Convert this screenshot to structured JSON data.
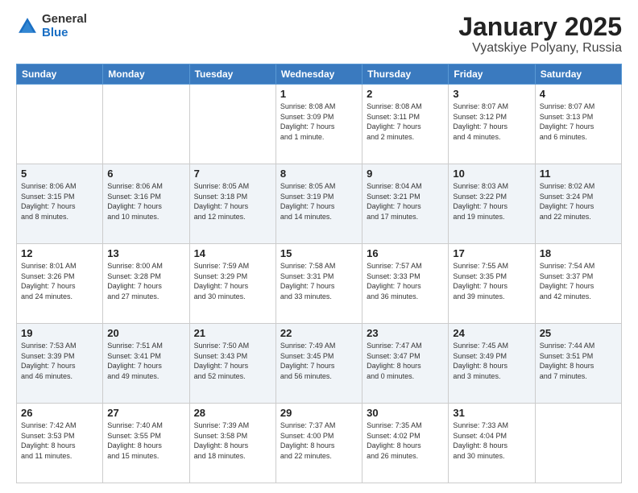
{
  "logo": {
    "general": "General",
    "blue": "Blue"
  },
  "title": "January 2025",
  "subtitle": "Vyatskiye Polyany, Russia",
  "days_of_week": [
    "Sunday",
    "Monday",
    "Tuesday",
    "Wednesday",
    "Thursday",
    "Friday",
    "Saturday"
  ],
  "weeks": [
    [
      {
        "day": "",
        "info": ""
      },
      {
        "day": "",
        "info": ""
      },
      {
        "day": "",
        "info": ""
      },
      {
        "day": "1",
        "info": "Sunrise: 8:08 AM\nSunset: 3:09 PM\nDaylight: 7 hours\nand 1 minute."
      },
      {
        "day": "2",
        "info": "Sunrise: 8:08 AM\nSunset: 3:11 PM\nDaylight: 7 hours\nand 2 minutes."
      },
      {
        "day": "3",
        "info": "Sunrise: 8:07 AM\nSunset: 3:12 PM\nDaylight: 7 hours\nand 4 minutes."
      },
      {
        "day": "4",
        "info": "Sunrise: 8:07 AM\nSunset: 3:13 PM\nDaylight: 7 hours\nand 6 minutes."
      }
    ],
    [
      {
        "day": "5",
        "info": "Sunrise: 8:06 AM\nSunset: 3:15 PM\nDaylight: 7 hours\nand 8 minutes."
      },
      {
        "day": "6",
        "info": "Sunrise: 8:06 AM\nSunset: 3:16 PM\nDaylight: 7 hours\nand 10 minutes."
      },
      {
        "day": "7",
        "info": "Sunrise: 8:05 AM\nSunset: 3:18 PM\nDaylight: 7 hours\nand 12 minutes."
      },
      {
        "day": "8",
        "info": "Sunrise: 8:05 AM\nSunset: 3:19 PM\nDaylight: 7 hours\nand 14 minutes."
      },
      {
        "day": "9",
        "info": "Sunrise: 8:04 AM\nSunset: 3:21 PM\nDaylight: 7 hours\nand 17 minutes."
      },
      {
        "day": "10",
        "info": "Sunrise: 8:03 AM\nSunset: 3:22 PM\nDaylight: 7 hours\nand 19 minutes."
      },
      {
        "day": "11",
        "info": "Sunrise: 8:02 AM\nSunset: 3:24 PM\nDaylight: 7 hours\nand 22 minutes."
      }
    ],
    [
      {
        "day": "12",
        "info": "Sunrise: 8:01 AM\nSunset: 3:26 PM\nDaylight: 7 hours\nand 24 minutes."
      },
      {
        "day": "13",
        "info": "Sunrise: 8:00 AM\nSunset: 3:28 PM\nDaylight: 7 hours\nand 27 minutes."
      },
      {
        "day": "14",
        "info": "Sunrise: 7:59 AM\nSunset: 3:29 PM\nDaylight: 7 hours\nand 30 minutes."
      },
      {
        "day": "15",
        "info": "Sunrise: 7:58 AM\nSunset: 3:31 PM\nDaylight: 7 hours\nand 33 minutes."
      },
      {
        "day": "16",
        "info": "Sunrise: 7:57 AM\nSunset: 3:33 PM\nDaylight: 7 hours\nand 36 minutes."
      },
      {
        "day": "17",
        "info": "Sunrise: 7:55 AM\nSunset: 3:35 PM\nDaylight: 7 hours\nand 39 minutes."
      },
      {
        "day": "18",
        "info": "Sunrise: 7:54 AM\nSunset: 3:37 PM\nDaylight: 7 hours\nand 42 minutes."
      }
    ],
    [
      {
        "day": "19",
        "info": "Sunrise: 7:53 AM\nSunset: 3:39 PM\nDaylight: 7 hours\nand 46 minutes."
      },
      {
        "day": "20",
        "info": "Sunrise: 7:51 AM\nSunset: 3:41 PM\nDaylight: 7 hours\nand 49 minutes."
      },
      {
        "day": "21",
        "info": "Sunrise: 7:50 AM\nSunset: 3:43 PM\nDaylight: 7 hours\nand 52 minutes."
      },
      {
        "day": "22",
        "info": "Sunrise: 7:49 AM\nSunset: 3:45 PM\nDaylight: 7 hours\nand 56 minutes."
      },
      {
        "day": "23",
        "info": "Sunrise: 7:47 AM\nSunset: 3:47 PM\nDaylight: 8 hours\nand 0 minutes."
      },
      {
        "day": "24",
        "info": "Sunrise: 7:45 AM\nSunset: 3:49 PM\nDaylight: 8 hours\nand 3 minutes."
      },
      {
        "day": "25",
        "info": "Sunrise: 7:44 AM\nSunset: 3:51 PM\nDaylight: 8 hours\nand 7 minutes."
      }
    ],
    [
      {
        "day": "26",
        "info": "Sunrise: 7:42 AM\nSunset: 3:53 PM\nDaylight: 8 hours\nand 11 minutes."
      },
      {
        "day": "27",
        "info": "Sunrise: 7:40 AM\nSunset: 3:55 PM\nDaylight: 8 hours\nand 15 minutes."
      },
      {
        "day": "28",
        "info": "Sunrise: 7:39 AM\nSunset: 3:58 PM\nDaylight: 8 hours\nand 18 minutes."
      },
      {
        "day": "29",
        "info": "Sunrise: 7:37 AM\nSunset: 4:00 PM\nDaylight: 8 hours\nand 22 minutes."
      },
      {
        "day": "30",
        "info": "Sunrise: 7:35 AM\nSunset: 4:02 PM\nDaylight: 8 hours\nand 26 minutes."
      },
      {
        "day": "31",
        "info": "Sunrise: 7:33 AM\nSunset: 4:04 PM\nDaylight: 8 hours\nand 30 minutes."
      },
      {
        "day": "",
        "info": ""
      }
    ]
  ]
}
